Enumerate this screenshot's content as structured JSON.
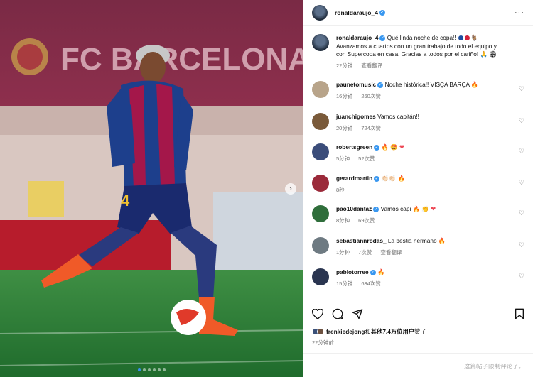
{
  "header": {
    "username": "ronaldaraujo_4",
    "more_icon": "more-horizontal-icon"
  },
  "photo": {
    "banner_text": "FC BARCELONA",
    "jersey_number": "4",
    "carousel_dots": 6,
    "active_dot": 0
  },
  "caption": {
    "username": "ronaldaraujo_4",
    "text_line1": "Qué linda noche de copa!! ",
    "text_line2": "Avanzamos a cuartos con un gran trabajo de todo el equipo y",
    "text_line3": "con Supercopa en casa. Gracias a todos por el cariño! ",
    "time": "22分钟",
    "translate": "查看翻译"
  },
  "comments": [
    {
      "username": "paunetomusic",
      "verified": true,
      "text": "Noche histórica!! VISÇA BARÇA",
      "time": "16分钟",
      "likes": "260次赞"
    },
    {
      "username": "juanchigomes",
      "verified": false,
      "text": "Vamos capitán!!",
      "time": "20分钟",
      "likes": "724次赞"
    },
    {
      "username": "robertsgreen",
      "verified": true,
      "text": "",
      "time": "5分钟",
      "likes": "52次赞"
    },
    {
      "username": "gerardmartin",
      "verified": true,
      "text": "",
      "time": "8秒",
      "likes": ""
    },
    {
      "username": "pao10dantaz",
      "verified": true,
      "text": "Vamos capi",
      "time": "8分钟",
      "likes": "69次赞"
    },
    {
      "username": "sebastiannrodas_",
      "verified": false,
      "text": "La bestia hermano",
      "time": "1分钟",
      "likes": "7次赞",
      "translate": "查看翻译"
    },
    {
      "username": "pablotorree",
      "verified": true,
      "text": "",
      "time": "15分钟",
      "likes": "634次赞"
    }
  ],
  "likes": {
    "user": "frenkiedejong",
    "mid": "和",
    "others": "其他7.4万位用户",
    "suffix": "赞了"
  },
  "post_time": "22分钟前",
  "comments_limited": "这篇帖子限制评论了。",
  "colors": {
    "accent": "#3897f0",
    "heart_red": "#ed4956"
  }
}
